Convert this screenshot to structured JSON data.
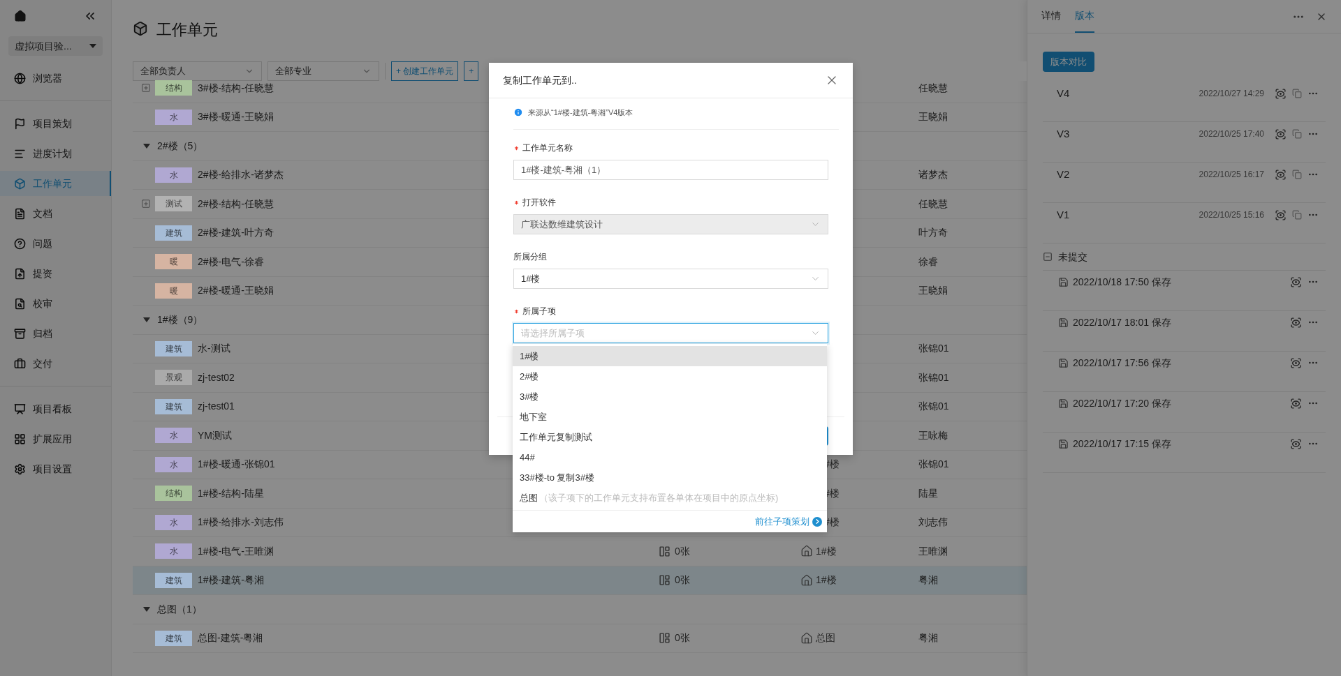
{
  "sidebar": {
    "project": "虚拟项目验...",
    "sections": [
      {
        "items": [
          {
            "label": "浏览器",
            "selected": false
          }
        ]
      },
      {
        "items": [
          {
            "label": "项目策划",
            "selected": false
          },
          {
            "label": "进度计划",
            "selected": false
          },
          {
            "label": "工作单元",
            "selected": true
          },
          {
            "label": "文档",
            "selected": false
          },
          {
            "label": "问题",
            "selected": false
          },
          {
            "label": "提资",
            "selected": false
          },
          {
            "label": "校审",
            "selected": false
          },
          {
            "label": "归档",
            "selected": false
          },
          {
            "label": "交付",
            "selected": false
          }
        ]
      },
      {
        "items": [
          {
            "label": "项目看板",
            "selected": false
          },
          {
            "label": "扩展应用",
            "selected": false
          },
          {
            "label": "项目设置",
            "selected": false
          }
        ]
      }
    ]
  },
  "page": {
    "title": "工作单元"
  },
  "filters": [
    {
      "value": "全部负责人"
    },
    {
      "value": "全部专业"
    }
  ],
  "actions": [
    {
      "label": "+ 创建工作单元"
    },
    {
      "label": "+"
    }
  ],
  "table": {
    "rows": [
      {
        "kind": "unit",
        "tag": "结构",
        "color": "#a9c39c",
        "name": "3#楼-结构-任晓慧",
        "owner": "任晓慧",
        "expandable": true,
        "selected": false
      },
      {
        "kind": "unit",
        "tag": "水",
        "color": "#b0a8d2",
        "name": "3#楼-暖通-王晓娟",
        "owner": "王晓娟",
        "expandable": false,
        "selected": false
      },
      {
        "kind": "group",
        "label": "2#楼",
        "count": "（5）",
        "expanded": true
      },
      {
        "kind": "unit",
        "tag": "水",
        "color": "#b0a8d2",
        "name": "2#楼-给排水-诸梦杰",
        "owner": "诸梦杰",
        "expandable": false,
        "selected": false
      },
      {
        "kind": "unit",
        "tag": "测试",
        "color": "#b2b2b2",
        "name": "2#楼-结构-任晓慧",
        "owner": "任晓慧",
        "expandable": true,
        "selected": false
      },
      {
        "kind": "unit",
        "tag": "建筑",
        "color": "#a6bcd6",
        "name": "2#楼-建筑-叶方奇",
        "owner": "叶方奇",
        "expandable": false,
        "selected": false
      },
      {
        "kind": "unit",
        "tag": "暖",
        "color": "#d6b4a2",
        "name": "2#楼-电气-徐睿",
        "owner": "徐睿",
        "expandable": false,
        "selected": false
      },
      {
        "kind": "unit",
        "tag": "暖",
        "color": "#d6b4a2",
        "name": "2#楼-暖通-王晓娟",
        "owner": "王晓娟",
        "expandable": false,
        "selected": false
      },
      {
        "kind": "group",
        "label": "1#楼",
        "count": "（9）",
        "expanded": true
      },
      {
        "kind": "unit",
        "tag": "建筑",
        "color": "#a6bcd6",
        "name": "水-测试",
        "owner": "张锦01",
        "expandable": false,
        "selected": false
      },
      {
        "kind": "unit",
        "tag": "景观",
        "color": "#aaaaaa",
        "name": "zj-test02",
        "owner": "张锦01",
        "expandable": false,
        "selected": false
      },
      {
        "kind": "unit",
        "tag": "建筑",
        "color": "#a6bcd6",
        "name": "zj-test01",
        "owner": "张锦01",
        "expandable": false,
        "selected": false
      },
      {
        "kind": "unit",
        "tag": "水",
        "color": "#b0a8d2",
        "name": "YM测试",
        "owner": "王咏梅",
        "expandable": false,
        "selected": false
      },
      {
        "kind": "unit",
        "tag": "水",
        "color": "#b0a8d2",
        "name": "1#楼-暖通-张锦01",
        "location": {
          "text": "#楼",
          "icon": false
        },
        "owner": "张锦01",
        "expandable": false,
        "selected": false
      },
      {
        "kind": "unit",
        "tag": "结构",
        "color": "#a9c39c",
        "name": "1#楼-结构-陆星",
        "location": {
          "text": "#楼",
          "icon": false
        },
        "owner": "陆星",
        "expandable": false,
        "selected": false
      },
      {
        "kind": "unit",
        "tag": "水",
        "color": "#b0a8d2",
        "name": "1#楼-给排水-刘志伟",
        "location": {
          "text": "#楼",
          "icon": false
        },
        "owner": "刘志伟",
        "expandable": false,
        "selected": false
      },
      {
        "kind": "unit",
        "tag": "水",
        "color": "#b0a8d2",
        "name": "1#楼-电气-王唯渊",
        "drawings": "0张",
        "location": {
          "text": "1#楼",
          "icon": true
        },
        "owner": "王唯渊",
        "expandable": false,
        "selected": false
      },
      {
        "kind": "unit",
        "tag": "建筑",
        "color": "#a6bcd6",
        "name": "1#楼-建筑-粤湘",
        "drawings": "0张",
        "location": {
          "text": "1#楼",
          "icon": true
        },
        "owner": "粤湘",
        "expandable": false,
        "selected": true
      },
      {
        "kind": "group",
        "label": "总图",
        "count": "（1）",
        "expanded": true
      },
      {
        "kind": "unit",
        "tag": "建筑",
        "color": "#a6bcd6",
        "name": "总图-建筑-粤湘",
        "drawings": "0张",
        "location": {
          "text": "总图",
          "icon": true
        },
        "owner": "粤湘",
        "expandable": false,
        "selected": false
      }
    ]
  },
  "panel": {
    "tabs": [
      {
        "label": "详情",
        "selected": false
      },
      {
        "label": "版本",
        "selected": true
      }
    ],
    "compare_button": "版本对比",
    "versions": [
      {
        "name": "V4",
        "time": "2022/10/27 14:29"
      },
      {
        "name": "V3",
        "time": "2022/10/25 17:40"
      },
      {
        "name": "V2",
        "time": "2022/10/25 16:17"
      },
      {
        "name": "V1",
        "time": "2022/10/25 15:16"
      }
    ],
    "uncommitted": {
      "label": "未提交",
      "expanded": true,
      "items": [
        {
          "text": "2022/10/18 17:50 保存"
        },
        {
          "text": "2022/10/17 18:01 保存"
        },
        {
          "text": "2022/10/17 17:56 保存"
        },
        {
          "text": "2022/10/17 17:20 保存"
        },
        {
          "text": "2022/10/17 17:15 保存"
        }
      ]
    }
  },
  "dialog": {
    "title": "复制工作单元到..",
    "source_note": "来源从“1#楼-建筑-粤湘”V4版本",
    "fields": [
      {
        "kind": "input",
        "label": "工作单元名称",
        "required": true,
        "value": "1#楼-建筑-粤湘（1）",
        "disabled": false,
        "focused": false
      },
      {
        "kind": "select",
        "label": "打开软件",
        "required": true,
        "value": "广联达数维建筑设计",
        "disabled": true,
        "focused": false
      },
      {
        "kind": "select",
        "label": "所属分组",
        "required": false,
        "value": "1#楼",
        "disabled": false,
        "focused": false
      },
      {
        "kind": "select",
        "label": "所属子项",
        "required": true,
        "placeholder": "请选择所属子项",
        "disabled": false,
        "focused": true
      }
    ],
    "dropdown": {
      "options": [
        {
          "label": "1#楼",
          "active": true
        },
        {
          "label": "2#楼",
          "active": false
        },
        {
          "label": "3#楼",
          "active": false
        },
        {
          "label": "地下室",
          "active": false
        },
        {
          "label": "工作单元复制测试",
          "active": false
        },
        {
          "label": "44#",
          "active": false
        },
        {
          "label": "33#楼-to 复制3#楼",
          "active": false
        },
        {
          "label": "总图",
          "hint": "（该子项下的工作单元支持布置各单体在项目中的原点坐标)",
          "active": false
        }
      ],
      "link": "前往子项策划"
    }
  }
}
